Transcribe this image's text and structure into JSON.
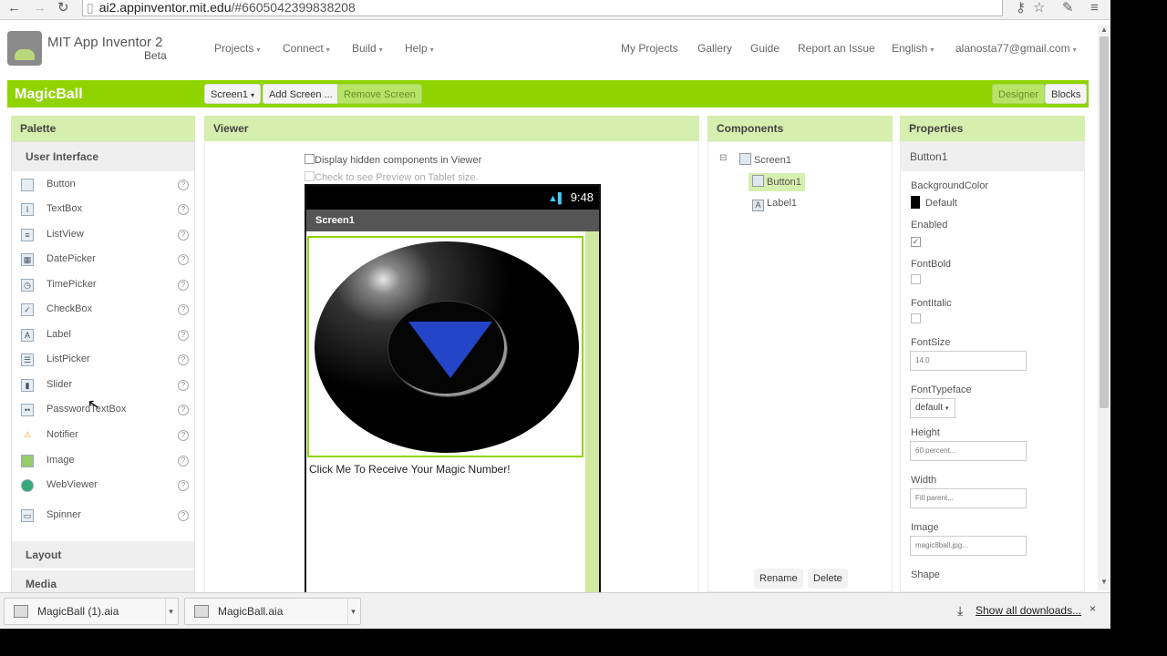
{
  "browser": {
    "url_host": "ai2.appinventor.mit.edu",
    "url_path": "/#6605042399838208"
  },
  "header": {
    "app_name": "MIT App Inventor 2",
    "beta": "Beta",
    "menus": [
      "Projects",
      "Connect",
      "Build",
      "Help"
    ],
    "links": [
      "My Projects",
      "Gallery",
      "Guide",
      "Report an Issue"
    ],
    "language": "English",
    "account": "alanosta77@gmail.com"
  },
  "toolbar": {
    "project": "MagicBall",
    "screen_select": "Screen1",
    "add_screen": "Add Screen ...",
    "remove_screen": "Remove Screen",
    "designer": "Designer",
    "blocks": "Blocks"
  },
  "palette": {
    "title": "Palette",
    "section": "User Interface",
    "items": [
      "Button",
      "TextBox",
      "ListView",
      "DatePicker",
      "TimePicker",
      "CheckBox",
      "Label",
      "ListPicker",
      "Slider",
      "PasswordTextBox",
      "Notifier",
      "Image",
      "WebViewer",
      "Spinner"
    ],
    "sections_below": [
      "Layout",
      "Media"
    ]
  },
  "viewer": {
    "title": "Viewer",
    "hidden_toggle": "Display hidden components in Viewer",
    "tablet_toggle": "Check to see Preview on Tablet size.",
    "status_time": "9:48",
    "screen_title": "Screen1",
    "label_text": "Click Me To Receive Your Magic Number!"
  },
  "components": {
    "title": "Components",
    "tree": [
      "Screen1",
      "Button1",
      "Label1"
    ],
    "rename": "Rename",
    "delete": "Delete"
  },
  "properties": {
    "title": "Properties",
    "component": "Button1",
    "bg_label": "BackgroundColor",
    "bg_value": "Default",
    "enabled": "Enabled",
    "fontbold": "FontBold",
    "fontitalic": "FontItalic",
    "fontsize": "FontSize",
    "fontsize_value": "14.0",
    "typeface": "FontTypeface",
    "typeface_value": "default",
    "height": "Height",
    "height_value": "60 percent...",
    "width": "Width",
    "width_value": "Fill parent...",
    "image": "Image",
    "image_value": "magic8ball.jpg...",
    "shape": "Shape"
  },
  "downloads": {
    "items": [
      "MagicBall (1).aia",
      "MagicBall.aia"
    ],
    "show_all": "Show all downloads...",
    "close": "×"
  },
  "colors": {
    "accent": "#8fd400",
    "panel_header": "#d6eeae"
  }
}
